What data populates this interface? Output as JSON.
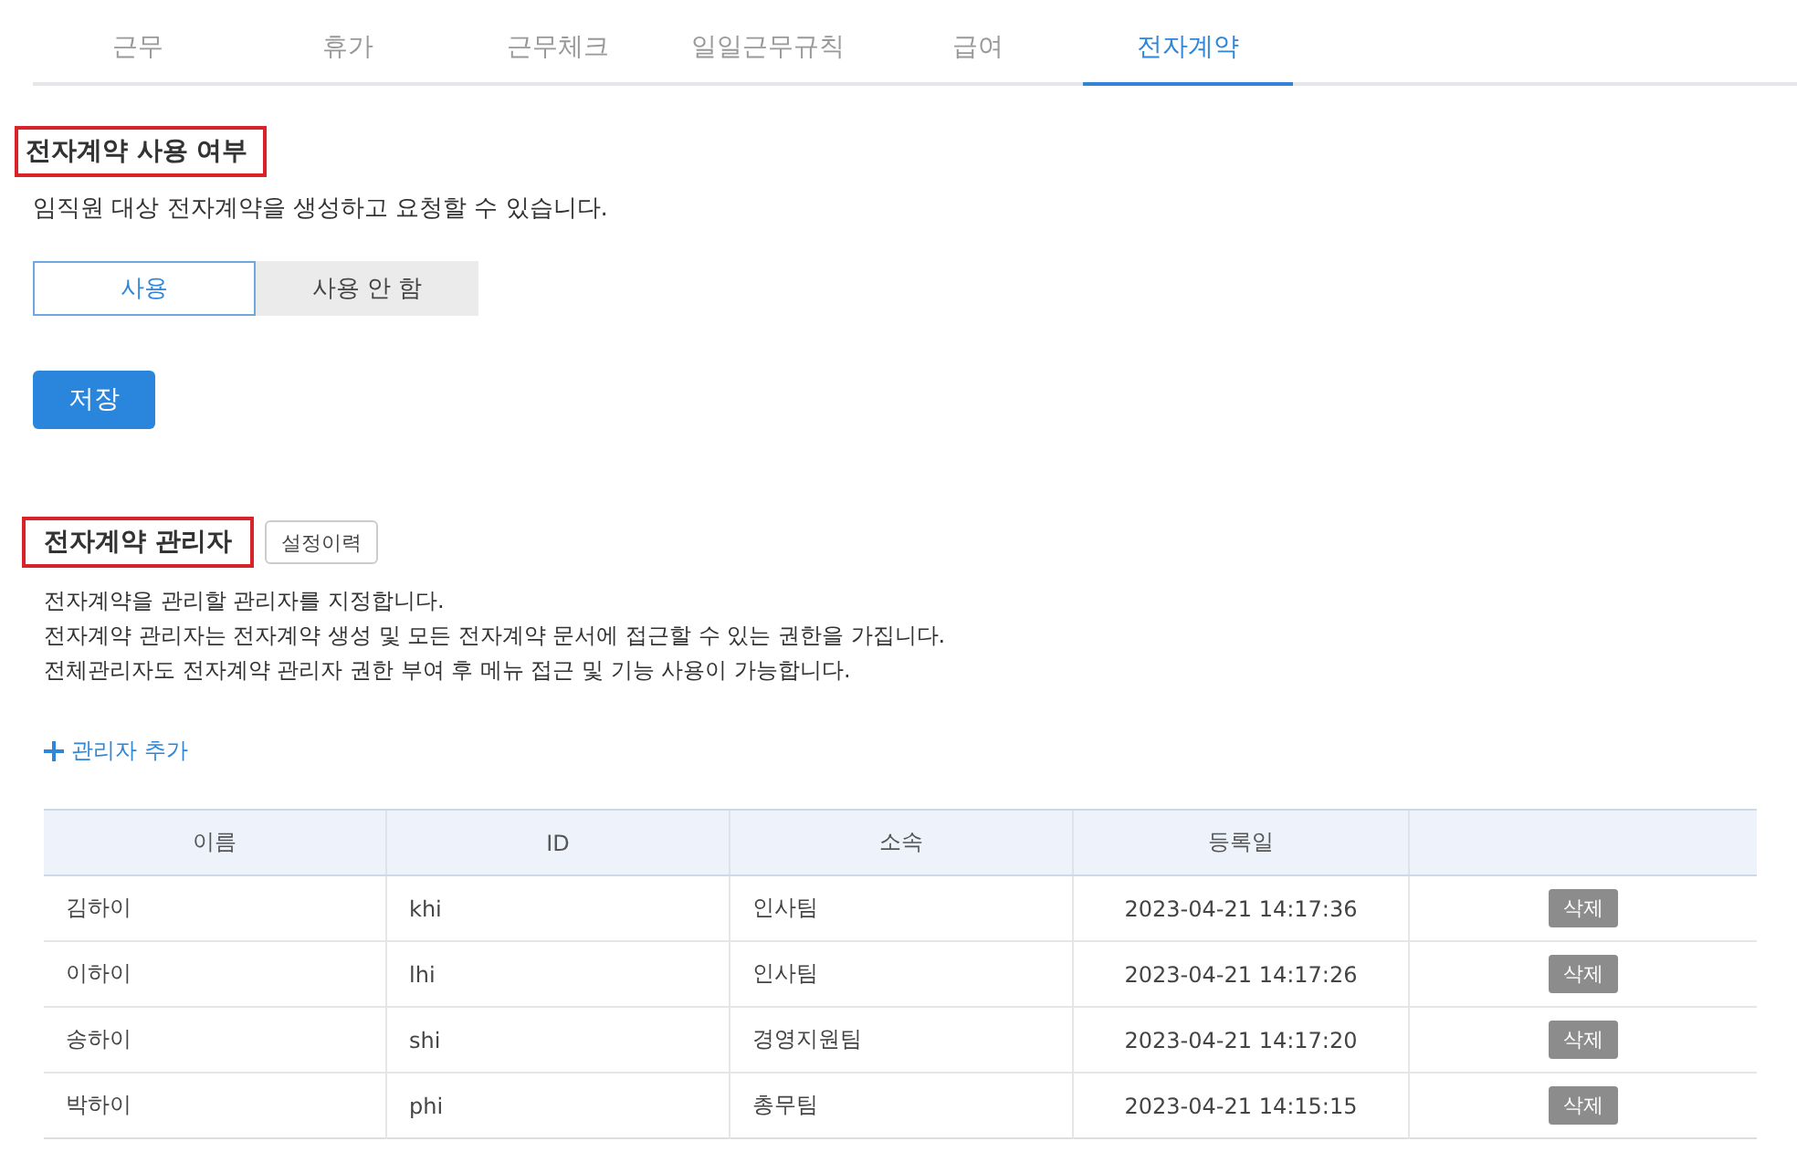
{
  "tabs": [
    {
      "label": "근무",
      "selected": false
    },
    {
      "label": "휴가",
      "selected": false
    },
    {
      "label": "근무체크",
      "selected": false
    },
    {
      "label": "일일근무규칙",
      "selected": false
    },
    {
      "label": "급여",
      "selected": false
    },
    {
      "label": "전자계약",
      "selected": true
    }
  ],
  "usage_section": {
    "title": "전자계약 사용 여부",
    "highlighted": true,
    "description": "임직원 대상 전자계약을 생성하고 요청할 수 있습니다.",
    "options": [
      {
        "label": "사용",
        "selected": true
      },
      {
        "label": "사용 안 함",
        "selected": false
      }
    ],
    "save_button": "저장"
  },
  "admin_section": {
    "title": "전자계약 관리자",
    "highlighted": true,
    "history_button": "설정이력",
    "description": [
      "전자계약을 관리할 관리자를 지정합니다.",
      "전자계약 관리자는 전자계약 생성 및 모든 전자계약 문서에 접근할 수 있는 권한을 가집니다.",
      "전체관리자도 전자계약 관리자 권한 부여 후 메뉴 접근 및 기능 사용이 가능합니다."
    ],
    "add_link": "관리자 추가",
    "table": {
      "columns": [
        "이름",
        "ID",
        "소속",
        "등록일"
      ],
      "rows": [
        {
          "name": "김하이",
          "id": "khi",
          "team": "인사팀",
          "registered": "2023-04-21 14:17:36",
          "action": "삭제"
        },
        {
          "name": "이하이",
          "id": "lhi",
          "team": "인사팀",
          "registered": "2023-04-21 14:17:26",
          "action": "삭제"
        },
        {
          "name": "송하이",
          "id": "shi",
          "team": "경영지원팀",
          "registered": "2023-04-21 14:17:20",
          "action": "삭제"
        },
        {
          "name": "박하이",
          "id": "phi",
          "team": "총무팀",
          "registered": "2023-04-21 14:15:15",
          "action": "삭제"
        }
      ]
    }
  }
}
